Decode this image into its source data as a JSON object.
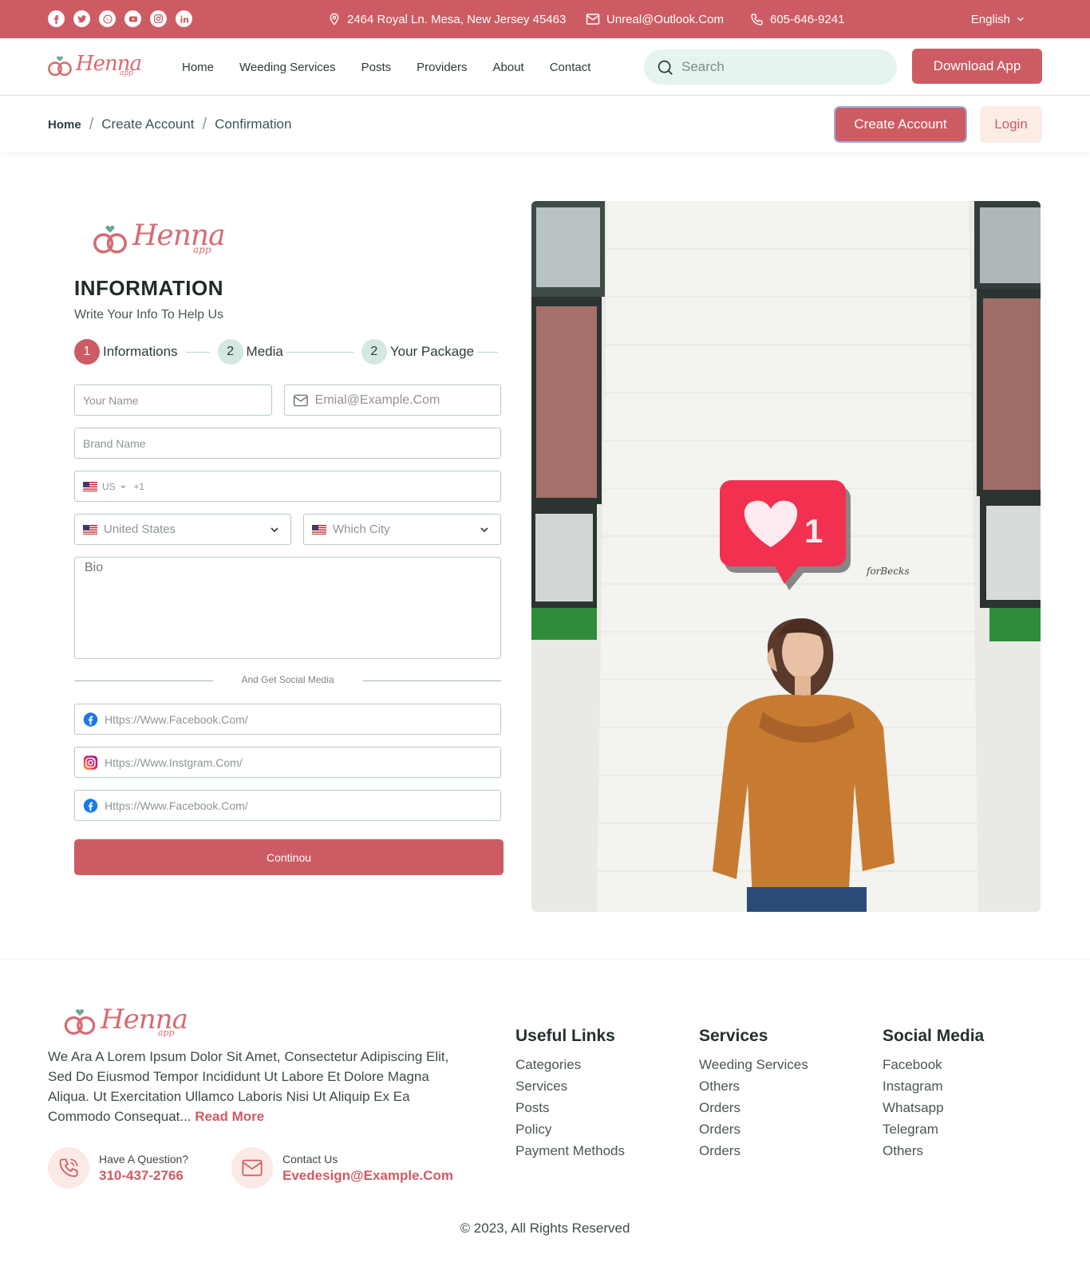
{
  "topbar": {
    "address": "2464 Royal Ln. Mesa, New Jersey 45463",
    "email": "Unreal@Outlook.Com",
    "phone": "605-646-9241",
    "language": "English",
    "social_icons": [
      "facebook-icon",
      "twitter-icon",
      "whatsapp-icon",
      "youtube-icon",
      "instagram-icon",
      "linkedin-icon"
    ]
  },
  "brand": {
    "name": "Henna",
    "sub": "app"
  },
  "nav": {
    "links": [
      "Home",
      "Weeding Services",
      "Posts",
      "Providers",
      "About",
      "Contact"
    ],
    "search_placeholder": "Search",
    "download_label": "Download App"
  },
  "breadcrumb": {
    "items": [
      "Home",
      "Create Account",
      "Confirmation"
    ],
    "create_label": "Create Account",
    "login_label": "Login"
  },
  "form": {
    "title": "INFORMATION",
    "subtitle": "Write Your Info To Help Us",
    "steps": [
      {
        "num": "1",
        "label": "Informations"
      },
      {
        "num": "2",
        "label": "Media"
      },
      {
        "num": "2",
        "label": "Your Package"
      }
    ],
    "name_placeholder": "Your Name",
    "email_placeholder": "Emial@Example.Com",
    "brand_placeholder": "Brand Name",
    "phone_country": "US",
    "phone_prefix": "+1",
    "country_value": "United States",
    "city_placeholder": "Which City",
    "bio_placeholder": "Bio",
    "divider_text": "And  Get Social Media",
    "social_fields": [
      {
        "icon": "facebook-icon",
        "placeholder": "Https://Www.Facebook.Com/"
      },
      {
        "icon": "instagram-icon",
        "placeholder": "Https://Www.Instgram.Com/"
      },
      {
        "icon": "facebook-icon",
        "placeholder": "Https://Www.Facebook.Com/"
      }
    ],
    "continue_label": "Continou"
  },
  "photo": {
    "wall_text": "forBecks",
    "like_count": "1"
  },
  "footer": {
    "about": "We Ara A Lorem Ipsum Dolor Sit Amet, Consectetur Adipiscing Elit, Sed Do Eiusmod Tempor Incididunt Ut Labore Et Dolore Magna Aliqua. Ut Exercitation Ullamco Laboris Nisi Ut Aliquip Ex Ea Commodo Consequat...",
    "read_more": "Read More",
    "question_label": "Have A Question?",
    "question_phone": "310-437-2766",
    "contact_label": "Contact Us",
    "contact_email": "Evedesign@Example.Com",
    "columns": [
      {
        "title": "Useful Links",
        "items": [
          "Categories",
          "Services",
          "Posts",
          "Policy",
          "Payment Methods"
        ]
      },
      {
        "title": "Services",
        "items": [
          "Weeding Services",
          "Others",
          "Orders",
          "Orders",
          "Orders"
        ]
      },
      {
        "title": "Social Media",
        "items": [
          "Facebook",
          "Instagram",
          "Whatsapp",
          "Telegram",
          "Others"
        ]
      }
    ],
    "copyright": "© 2023, All Rights Reserved"
  },
  "colors": {
    "primary": "#cd5b63",
    "mint": "#e6f4ee",
    "step_idle": "#d2e8e0"
  }
}
